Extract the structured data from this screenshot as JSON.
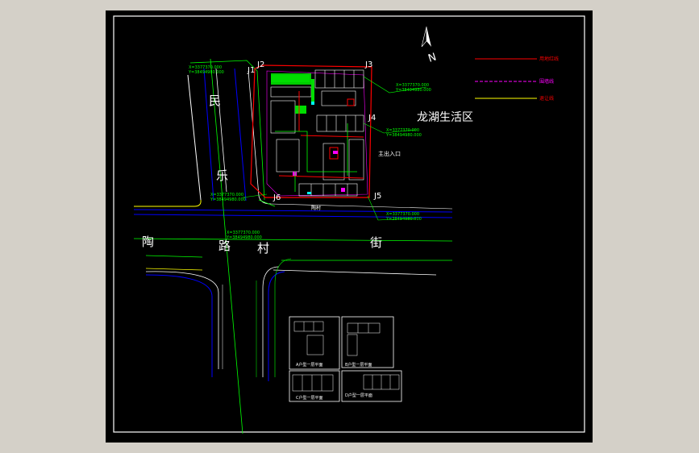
{
  "drawing": {
    "north_label": "N",
    "district_label": "龙湖生活区",
    "entrance_label": "主出入口",
    "road_chars_v": [
      "民",
      "乐"
    ],
    "road_chars_h": [
      "陶",
      "路",
      "村",
      "街"
    ],
    "road_label_small": "陶村",
    "junctions": [
      "J1",
      "J2",
      "J3",
      "J4",
      "J5",
      "J6"
    ],
    "coord_labels": [
      "X=3377370.000",
      "Y=38494980.000"
    ],
    "legend": [
      {
        "label": "用地红线",
        "color": "#ff0000"
      },
      {
        "label": "围墙线",
        "color": "#ff00ff"
      },
      {
        "label": "退让线",
        "color": "#ffff00"
      }
    ],
    "detail_views": [
      {
        "title": "A户型一层平面"
      },
      {
        "title": "B户型一层平面"
      },
      {
        "title": "C户型一层平面"
      },
      {
        "title": "D户型一层平面"
      }
    ]
  },
  "colors": {
    "background": "#000000",
    "frame": "#ffffff",
    "road": "#0000ff",
    "axis": "#00ff00",
    "boundary": "#ff0000",
    "text": "#ffffff"
  }
}
